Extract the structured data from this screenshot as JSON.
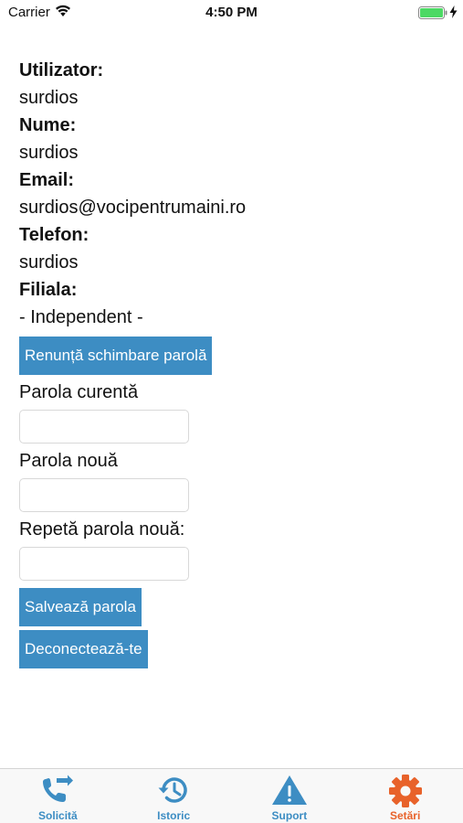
{
  "status_bar": {
    "carrier": "Carrier",
    "time": "4:50 PM"
  },
  "profile": {
    "fields": [
      {
        "label": "Utilizator:",
        "value": "surdios"
      },
      {
        "label": "Nume:",
        "value": "surdios"
      },
      {
        "label": "Email:",
        "value": "surdios@vocipentrumaini.ro"
      },
      {
        "label": "Telefon:",
        "value": "surdios"
      },
      {
        "label": "Filiala:",
        "value": "- Independent -"
      }
    ]
  },
  "password_form": {
    "cancel_label": "Renunță schimbare parolă",
    "current_label": "Parola curentă",
    "current_value": "",
    "new_label": "Parola nouă",
    "new_value": "",
    "repeat_label": "Repetă parola nouă:",
    "repeat_value": "",
    "save_label": "Salvează parola"
  },
  "logout_label": "Deconectează-te",
  "tab_bar": {
    "tabs": [
      {
        "label": "Solicită",
        "icon": "phone-transfer-icon",
        "active": false
      },
      {
        "label": "Istoric",
        "icon": "history-icon",
        "active": false
      },
      {
        "label": "Suport",
        "icon": "warning-icon",
        "active": false
      },
      {
        "label": "Setări",
        "icon": "gear-icon",
        "active": true
      }
    ]
  },
  "colors": {
    "accent": "#3d8dc3",
    "active_tab": "#e8622a",
    "battery": "#4cd964"
  }
}
